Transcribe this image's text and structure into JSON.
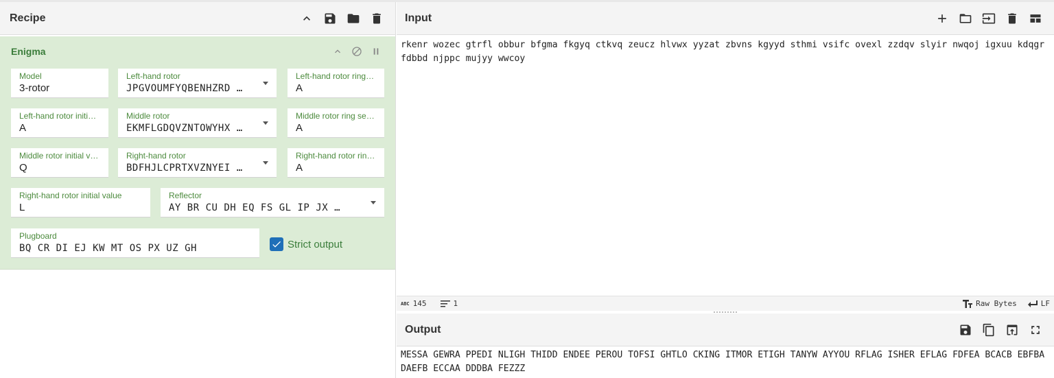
{
  "recipe": {
    "title": "Recipe",
    "icons": [
      "chevron-up-icon",
      "save-icon",
      "folder-icon",
      "trash-icon"
    ]
  },
  "operation": {
    "name": "Enigma",
    "fields": {
      "model": {
        "label": "Model",
        "value": "3-rotor"
      },
      "left_rotor": {
        "label": "Left-hand rotor",
        "value": "JPGVOUMFYQBENHZRD …"
      },
      "left_ring": {
        "label": "Left-hand rotor ring se…",
        "value": "A"
      },
      "left_initial": {
        "label": "Left-hand rotor initial v…",
        "value": "A"
      },
      "middle_rotor": {
        "label": "Middle rotor",
        "value": "EKMFLGDQVZNTOWYHX …"
      },
      "middle_ring": {
        "label": "Middle rotor ring setting",
        "value": "A"
      },
      "middle_initial": {
        "label": "Middle rotor initial value",
        "value": "Q"
      },
      "right_rotor": {
        "label": "Right-hand rotor",
        "value": "BDFHJLCPRTXVZNYEI …"
      },
      "right_ring": {
        "label": "Right-hand rotor ring s…",
        "value": "A"
      },
      "right_initial": {
        "label": "Right-hand rotor initial value",
        "value": "L"
      },
      "reflector": {
        "label": "Reflector",
        "value": "AY BR CU DH EQ FS GL IP JX …"
      },
      "plugboard": {
        "label": "Plugboard",
        "value": "BQ CR DI EJ KW MT OS PX UZ GH"
      }
    },
    "strict_output": {
      "label": "Strict output",
      "checked": true
    }
  },
  "input": {
    "title": "Input",
    "text": "rkenr wozec gtrfl obbur bfgma fkgyq ctkvq zeucz hlvwx yyzat zbvns kgyyd sthmi vsifc ovexl zzdqv slyir nwqoj igxuu kdqgr fdbbd njppc mujyy wwcoy"
  },
  "status": {
    "abc": "ABC",
    "char_count": "145",
    "line_count": "1",
    "encoding": "Raw Bytes",
    "eol": "LF"
  },
  "output": {
    "title": "Output",
    "text": "MESSA GEWRA PPEDI NLIGH THIDD ENDEE PEROU TOFSI GHTLO CKING ITMOR ETIGH TANYW AYYOU RFLAG ISHER EFLAG FDFEA BCACB EBFBA DAEFB ECCAA DDDBA FEZZZ"
  },
  "colors": {
    "op_bg": "#dcecd6",
    "label_green": "#4b8a3c",
    "checkbox_blue": "#1f6fb8"
  }
}
